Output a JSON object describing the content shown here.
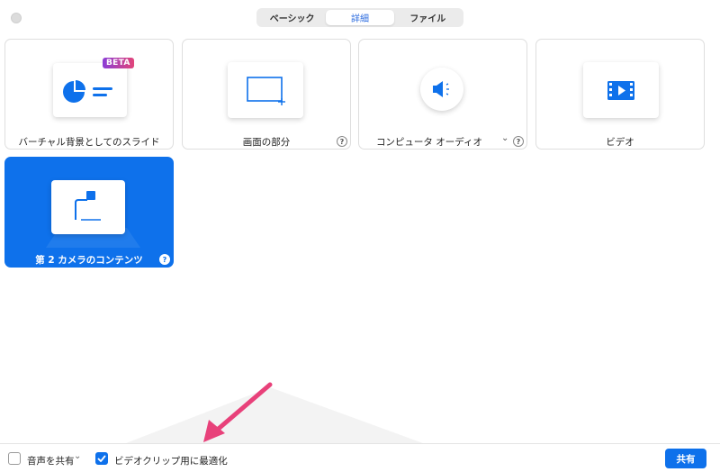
{
  "tabs": [
    {
      "label": "ベーシック",
      "active": false
    },
    {
      "label": "詳細",
      "active": true
    },
    {
      "label": "ファイル",
      "active": false
    }
  ],
  "cards": {
    "slides": {
      "label": "バーチャル背景としてのスライド",
      "badge": "BETA",
      "icon": "pie-chart-slide-icon"
    },
    "screen_portion": {
      "label": "画面の部分",
      "icon": "screen-portion-icon",
      "help": "?"
    },
    "computer_audio": {
      "label": "コンピュータ オーディオ",
      "icon": "speaker-icon",
      "help": "?",
      "dropdown": "⌄"
    },
    "video": {
      "label": "ビデオ",
      "icon": "film-icon"
    },
    "second_camera": {
      "label": "第 2 カメラのコンテンツ",
      "icon": "document-camera-icon",
      "help": "?",
      "selected": true
    }
  },
  "bottom": {
    "share_audio_label": "音声を共有",
    "share_audio_checked": false,
    "share_audio_dropdown": "⌄",
    "optimize_video_label": "ビデオクリップ用に最適化",
    "optimize_video_checked": true,
    "share_button": "共有"
  },
  "colors": {
    "accent": "#0e71eb",
    "annotation_arrow": "#e8417a"
  }
}
